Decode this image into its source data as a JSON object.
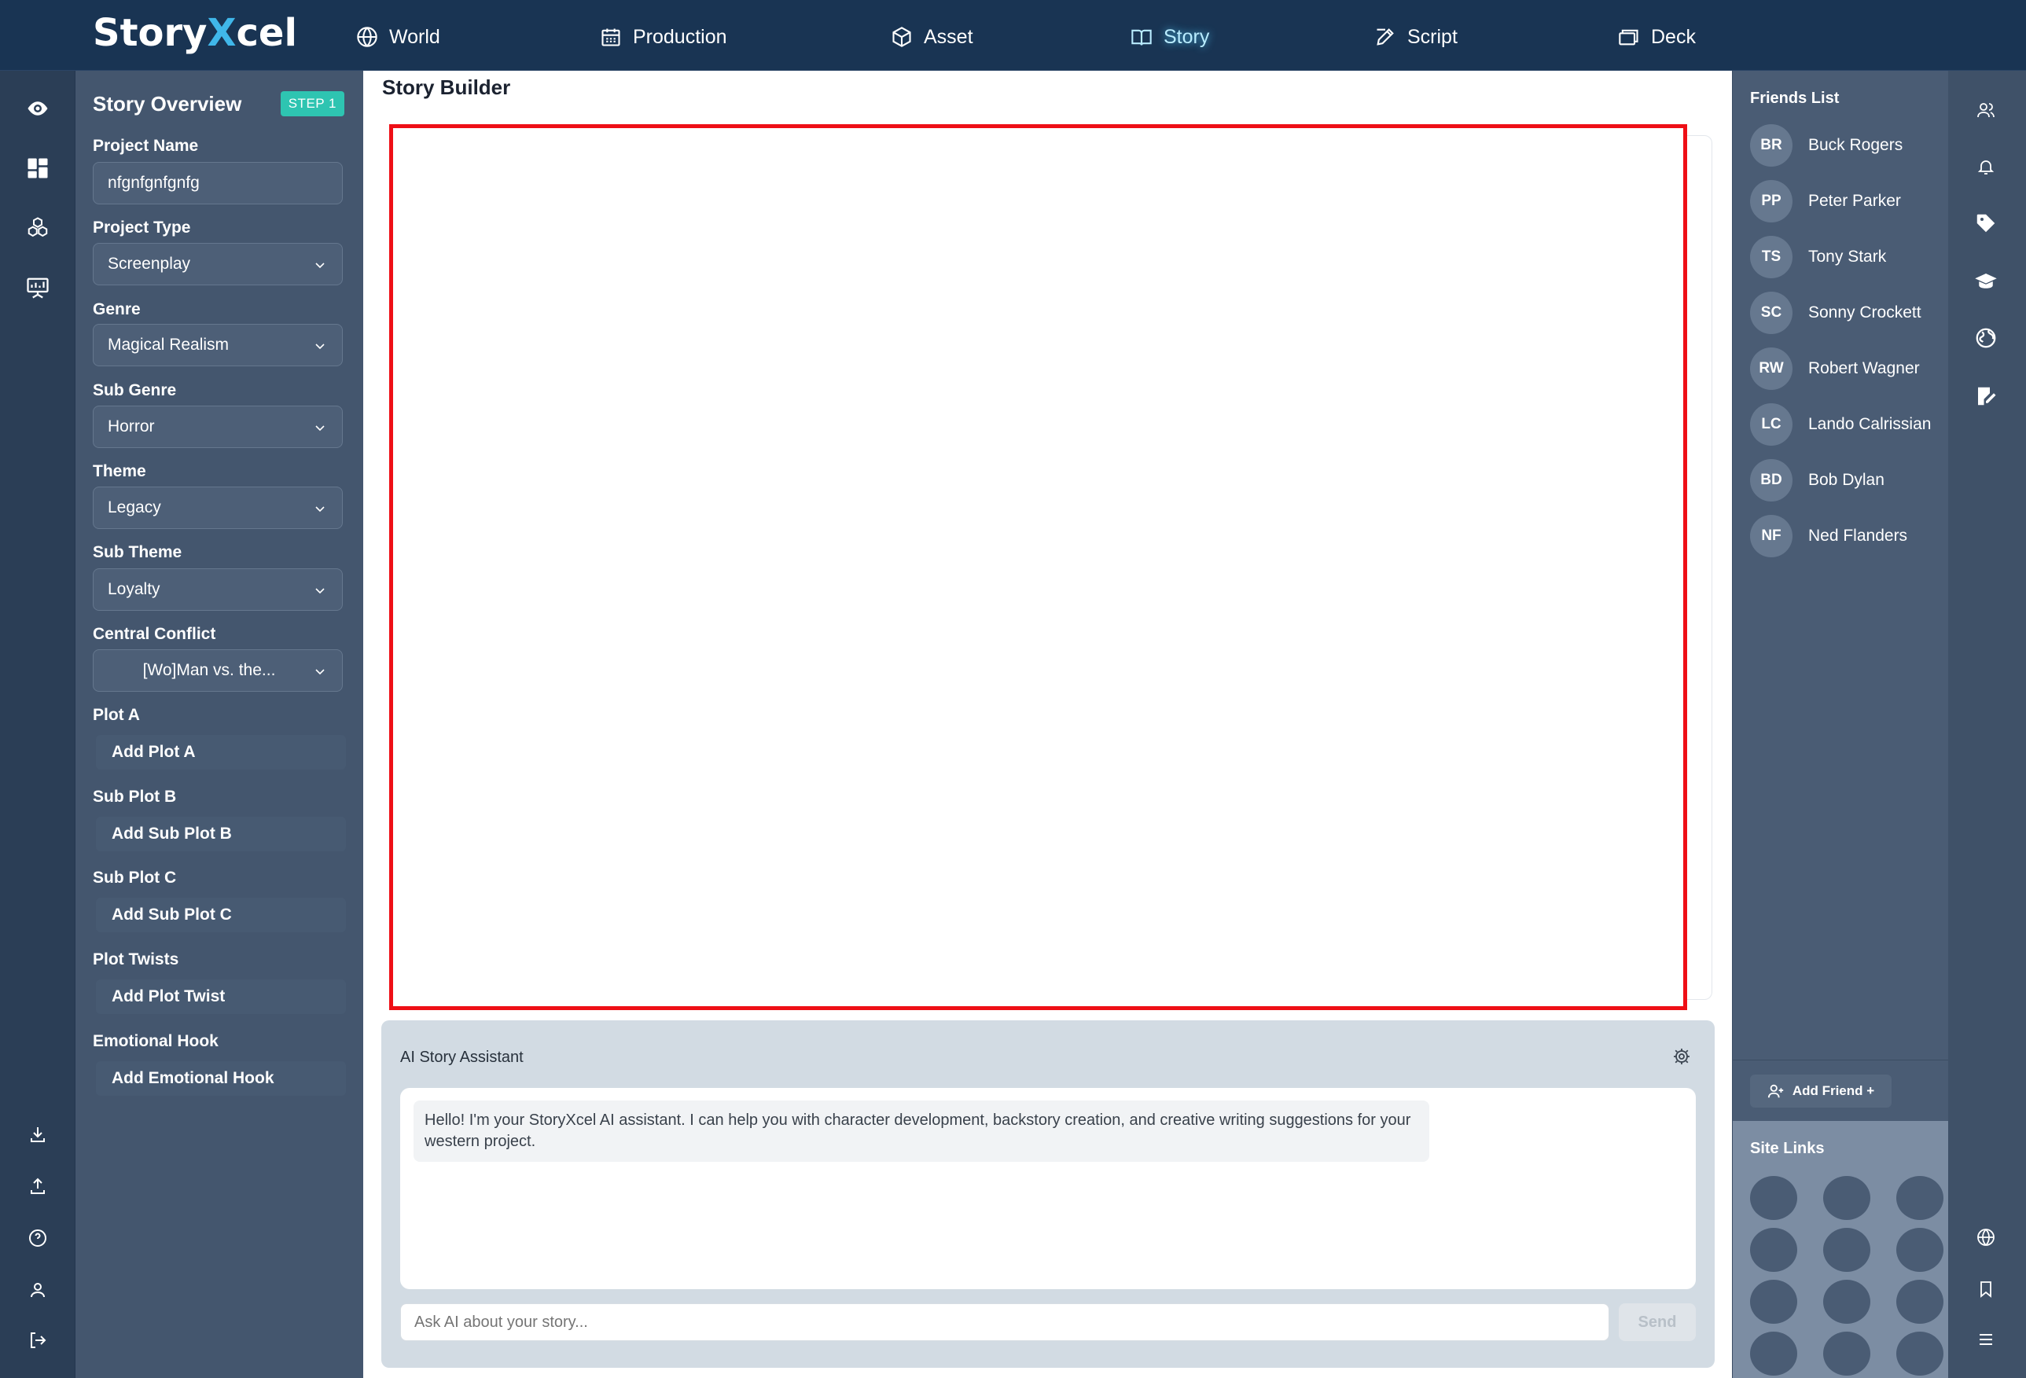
{
  "app": {
    "logo_part1": "Story",
    "logo_x": "X",
    "logo_part2": "cel"
  },
  "nav": {
    "items": [
      {
        "label": "World",
        "icon": "globe-icon"
      },
      {
        "label": "Production",
        "icon": "calendar-icon"
      },
      {
        "label": "Asset",
        "icon": "cube-icon"
      },
      {
        "label": "Story",
        "icon": "book-icon",
        "active": true
      },
      {
        "label": "Script",
        "icon": "pen-nib-icon"
      },
      {
        "label": "Deck",
        "icon": "cards-icon"
      }
    ]
  },
  "left_rail": {
    "top_icons": [
      "eye-icon",
      "dashboard-icon",
      "cubes-icon",
      "presentation-icon"
    ],
    "bottom_icons": [
      "download-icon",
      "upload-icon",
      "help-icon",
      "user-icon",
      "logout-icon"
    ]
  },
  "overview": {
    "title": "Story Overview",
    "step": "STEP 1",
    "fields": [
      {
        "label": "Project Name",
        "value": "nfgnfgnfgnfg"
      },
      {
        "label": "Project Type",
        "value": "Screenplay"
      },
      {
        "label": "Genre",
        "value": "Magical Realism"
      },
      {
        "label": "Sub Genre",
        "value": "Horror"
      },
      {
        "label": "Theme",
        "value": "Legacy"
      },
      {
        "label": "Sub Theme",
        "value": "Loyalty"
      },
      {
        "label": "Central Conflict",
        "value": "[Wo]Man vs. the..."
      }
    ],
    "sections": [
      {
        "label": "Plot A",
        "button": "Add Plot A"
      },
      {
        "label": "Sub Plot B",
        "button": "Add Sub Plot B"
      },
      {
        "label": "Sub Plot C",
        "button": "Add Sub Plot C"
      },
      {
        "label": "Plot Twists",
        "button": "Add Plot Twist"
      },
      {
        "label": "Emotional Hook",
        "button": "Add Emotional Hook"
      }
    ]
  },
  "main": {
    "title": "Story Builder"
  },
  "ai": {
    "title": "AI Story Assistant",
    "message": "Hello! I'm your StoryXcel AI assistant. I can help you with character development, backstory creation, and creative writing suggestions for your western project.",
    "input_placeholder": "Ask AI about your story...",
    "send_label": "Send"
  },
  "friends": {
    "title": "Friends List",
    "list": [
      {
        "initials": "BR",
        "name": "Buck Rogers"
      },
      {
        "initials": "PP",
        "name": "Peter Parker"
      },
      {
        "initials": "TS",
        "name": "Tony Stark"
      },
      {
        "initials": "SC",
        "name": "Sonny Crockett"
      },
      {
        "initials": "RW",
        "name": "Robert Wagner"
      },
      {
        "initials": "LC",
        "name": "Lando Calrissian"
      },
      {
        "initials": "BD",
        "name": "Bob Dylan"
      },
      {
        "initials": "NF",
        "name": "Ned Flanders"
      }
    ],
    "add_label": "Add Friend +"
  },
  "site_links": {
    "title": "Site Links"
  },
  "right_rail": {
    "top_icons": [
      "users-icon",
      "bell-icon",
      "tag-icon",
      "graduation-cap-icon",
      "globe-hand-icon",
      "notes-icon"
    ],
    "bottom_icons": [
      "globe-icon",
      "bookmark-icon",
      "menu-icon"
    ]
  },
  "colors": {
    "topbar": "#193453",
    "accent": "#40b7ea",
    "step_badge": "#2ec4b1",
    "frame_highlight": "#ee0f16"
  }
}
